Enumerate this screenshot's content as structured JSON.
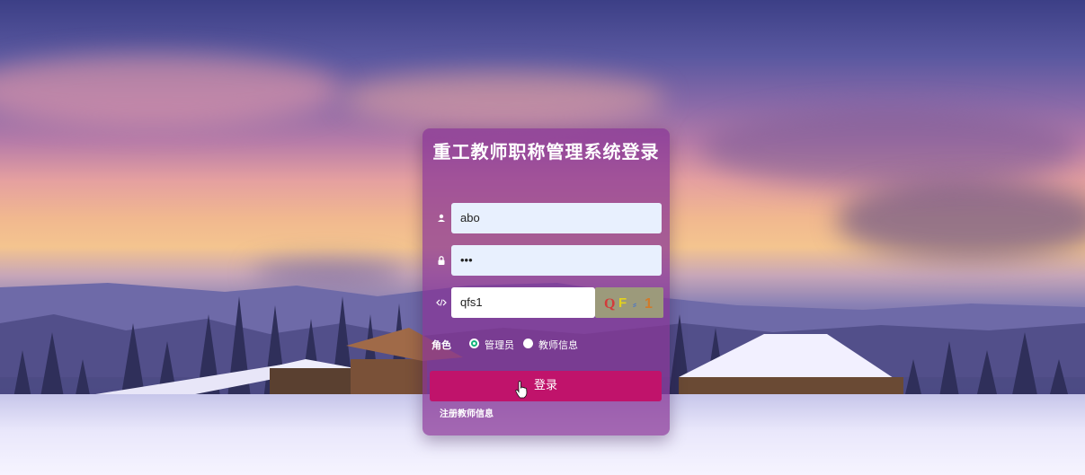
{
  "login": {
    "title": "重工教师职称管理系统登录",
    "username_value": "abo",
    "password_value": "•••",
    "captcha_value": "qfs1",
    "captcha_image_text": "QF⸗1",
    "role_label": "角色",
    "roles": [
      "管理员",
      "教师信息"
    ],
    "selected_role": "管理员",
    "login_button": "登录",
    "register_link": "注册教师信息"
  },
  "icons": {
    "username": "user-icon",
    "password": "lock-icon",
    "captcha": "code-icon",
    "pointer": "hand-cursor-icon"
  },
  "colors": {
    "panel": "#8834968f",
    "login_button": "#c0136b",
    "input_bg": "#e8f0fe",
    "radio_checked": "#12b37c"
  }
}
